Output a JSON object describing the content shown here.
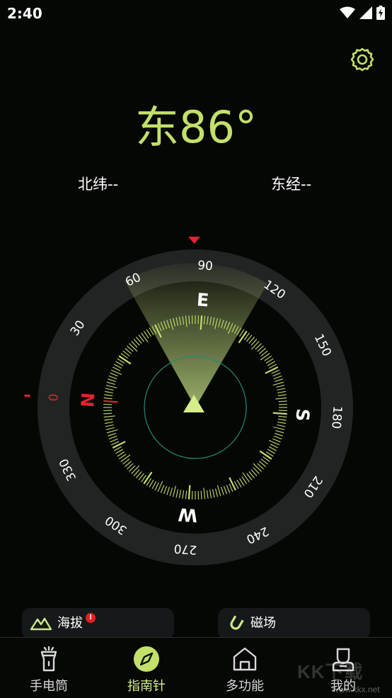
{
  "status": {
    "time": "2:40"
  },
  "compass": {
    "heading_text": "东86°",
    "heading_degrees": 86,
    "latitude_text": "北纬--",
    "longitude_text": "东经--",
    "dial_numbers": [
      "0",
      "30",
      "60",
      "90",
      "120",
      "150",
      "180",
      "210",
      "240",
      "270",
      "300",
      "330"
    ],
    "cardinals": {
      "north": "N",
      "east": "E",
      "south": "S",
      "west": "W"
    },
    "accent_color": "#c3e06a",
    "north_color": "#e3232f"
  },
  "cards": [
    {
      "label": "海拔",
      "icon": "mountain-icon",
      "has_badge": true,
      "badge_text": "!"
    },
    {
      "label": "磁场",
      "icon": "magnet-icon"
    }
  ],
  "nav": [
    {
      "label": "手电筒",
      "icon": "flashlight-icon",
      "active": false
    },
    {
      "label": "指南针",
      "icon": "compass-icon",
      "active": true
    },
    {
      "label": "多功能",
      "icon": "home-icon",
      "active": false
    },
    {
      "label": "我的",
      "icon": "profile-icon",
      "active": false
    }
  ],
  "watermark": {
    "big": "KK下载",
    "small": "www.kkx.net"
  }
}
